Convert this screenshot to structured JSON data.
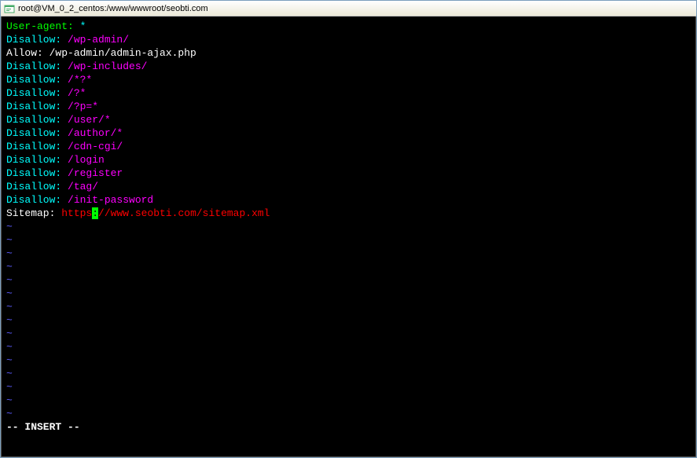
{
  "window": {
    "title": "root@VM_0_2_centos:/www/wwwroot/seobti.com"
  },
  "lines": [
    {
      "segments": [
        {
          "text": "User-agent:",
          "cls": "green"
        },
        {
          "text": " *",
          "cls": "cyan"
        }
      ]
    },
    {
      "segments": [
        {
          "text": "Disallow:",
          "cls": "cyan"
        },
        {
          "text": " /wp-admin/",
          "cls": "magenta"
        }
      ]
    },
    {
      "segments": [
        {
          "text": "Allow: /wp-admin/admin-ajax.php",
          "cls": "white"
        }
      ]
    },
    {
      "segments": [
        {
          "text": "Disallow:",
          "cls": "cyan"
        },
        {
          "text": " /wp-includes/",
          "cls": "magenta"
        }
      ]
    },
    {
      "segments": [
        {
          "text": "Disallow:",
          "cls": "cyan"
        },
        {
          "text": " /*?*",
          "cls": "magenta"
        }
      ]
    },
    {
      "segments": [
        {
          "text": "Disallow:",
          "cls": "cyan"
        },
        {
          "text": " /?*",
          "cls": "magenta"
        }
      ]
    },
    {
      "segments": [
        {
          "text": "Disallow:",
          "cls": "cyan"
        },
        {
          "text": " /?p=*",
          "cls": "magenta"
        }
      ]
    },
    {
      "segments": [
        {
          "text": "Disallow:",
          "cls": "cyan"
        },
        {
          "text": " /user/*",
          "cls": "magenta"
        }
      ]
    },
    {
      "segments": [
        {
          "text": "Disallow:",
          "cls": "cyan"
        },
        {
          "text": " /author/*",
          "cls": "magenta"
        }
      ]
    },
    {
      "segments": [
        {
          "text": "Disallow:",
          "cls": "cyan"
        },
        {
          "text": " /cdn-cgi/",
          "cls": "magenta"
        }
      ]
    },
    {
      "segments": [
        {
          "text": "Disallow:",
          "cls": "cyan"
        },
        {
          "text": " /login",
          "cls": "magenta"
        }
      ]
    },
    {
      "segments": [
        {
          "text": "Disallow:",
          "cls": "cyan"
        },
        {
          "text": " /register",
          "cls": "magenta"
        }
      ]
    },
    {
      "segments": [
        {
          "text": "Disallow:",
          "cls": "cyan"
        },
        {
          "text": " /tag/",
          "cls": "magenta"
        }
      ]
    },
    {
      "segments": [
        {
          "text": "Disallow:",
          "cls": "cyan"
        },
        {
          "text": " /init-password",
          "cls": "magenta"
        }
      ]
    },
    {
      "segments": [
        {
          "text": "",
          "cls": "white"
        }
      ]
    },
    {
      "segments": [
        {
          "text": "Sitemap: ",
          "cls": "white"
        },
        {
          "text": "https",
          "cls": "red"
        },
        {
          "text": ":",
          "cls": "cursor"
        },
        {
          "text": "//www.seobti.com/sitemap.xml",
          "cls": "red"
        }
      ]
    }
  ],
  "tilde_count": 15,
  "tilde_char": "~",
  "status": "-- INSERT --"
}
